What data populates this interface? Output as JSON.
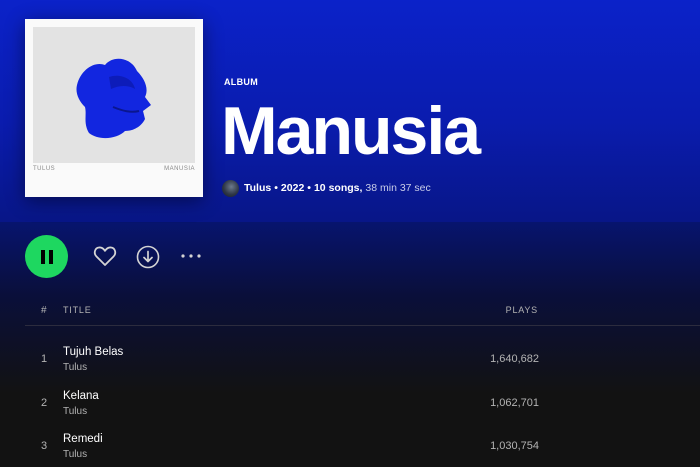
{
  "album": {
    "type_label": "ALBUM",
    "title": "Manusia",
    "artist": "Tulus",
    "year": "2022",
    "song_count": "10 songs,",
    "duration": "38 min 37 sec",
    "cover_left_text": "TULUS",
    "cover_right_text": "MANUSIA"
  },
  "controls": {
    "play_state": "playing",
    "more_label": "···"
  },
  "table": {
    "header": {
      "number": "#",
      "title": "TITLE",
      "plays": "PLAYS"
    },
    "tracks": [
      {
        "number": "1",
        "name": "Tujuh Belas",
        "artist": "Tulus",
        "plays": "1,640,682"
      },
      {
        "number": "2",
        "name": "Kelana",
        "artist": "Tulus",
        "plays": "1,062,701"
      },
      {
        "number": "3",
        "name": "Remedi",
        "artist": "Tulus",
        "plays": "1,030,754"
      }
    ]
  },
  "colors": {
    "hero_blue": "#0b22c9",
    "play_green": "#1ed760",
    "background": "#121212"
  }
}
